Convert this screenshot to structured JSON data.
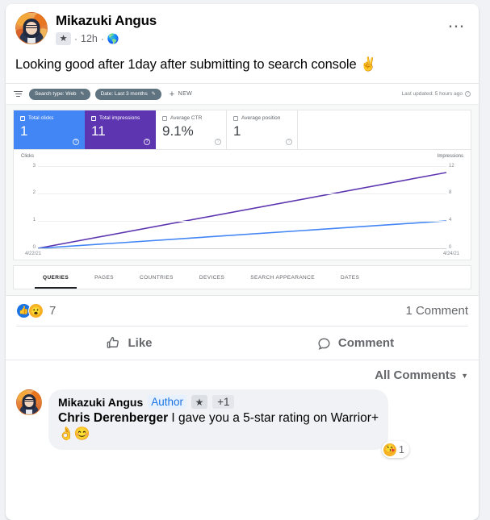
{
  "post": {
    "author": "Mikazuki Angus",
    "badge_icon": "star-icon",
    "time": "12h",
    "audience_icon": "public-globe-icon",
    "meta_dot": "·",
    "menu_icon": "ellipsis-icon",
    "text": "Looking good after 1day after submitting to search console ✌️"
  },
  "gsc": {
    "toolbar": {
      "filter_icon": "filter-icon",
      "chips": [
        {
          "label": "Search type: Web",
          "edit_icon": "pencil-icon"
        },
        {
          "label": "Date: Last 3 months",
          "edit_icon": "pencil-icon"
        }
      ],
      "new_label": "NEW",
      "new_icon": "plus-icon",
      "last_updated": "Last updated: 5 hours ago",
      "help_icon": "question-circle-icon"
    },
    "cards": [
      {
        "label": "Total clicks",
        "value": "1",
        "checked": true,
        "style": "blue",
        "check_mark": "✓"
      },
      {
        "label": "Total impressions",
        "value": "11",
        "checked": true,
        "style": "purple",
        "check_mark": "✓"
      },
      {
        "label": "Average CTR",
        "value": "9.1%",
        "checked": false,
        "style": "plain",
        "check_mark": ""
      },
      {
        "label": "Average position",
        "value": "1",
        "checked": false,
        "style": "plain",
        "check_mark": ""
      }
    ],
    "tabs": [
      {
        "label": "QUERIES",
        "active": true
      },
      {
        "label": "PAGES",
        "active": false
      },
      {
        "label": "COUNTRIES",
        "active": false
      },
      {
        "label": "DEVICES",
        "active": false
      },
      {
        "label": "SEARCH APPEARANCE",
        "active": false
      },
      {
        "label": "DATES",
        "active": false
      }
    ],
    "colors": {
      "clicks_line": "#4285f4",
      "impressions_line": "#5e35b1",
      "card_blue": "#4285f4",
      "card_purple": "#5e35b1"
    }
  },
  "chart_data": {
    "type": "line",
    "title": "",
    "xlabel": "",
    "ylabel": "Clicks",
    "y2label": "Impressions",
    "x": [
      "4/22/21",
      "4/24/21"
    ],
    "x_tick_labels": [
      "4/22/21",
      "4/24/21"
    ],
    "y_tick_labels": [
      "3",
      "2",
      "1",
      "0"
    ],
    "y2_tick_labels": [
      "12",
      "8",
      "4",
      "0"
    ],
    "ylim": [
      0,
      3
    ],
    "y2lim": [
      0,
      12
    ],
    "grid": true,
    "legend": "none",
    "series": [
      {
        "name": "Clicks",
        "axis": "left",
        "color": "#4285f4",
        "values": [
          0,
          1
        ]
      },
      {
        "name": "Impressions",
        "axis": "right",
        "color": "#5e35b1",
        "values": [
          0,
          11
        ]
      }
    ]
  },
  "engagement": {
    "reactions": [
      {
        "name": "like-reaction-icon",
        "glyph": "👍"
      },
      {
        "name": "wow-reaction-icon",
        "glyph": "😮"
      }
    ],
    "reaction_count": "7",
    "comment_count": "1 Comment"
  },
  "actions": [
    {
      "label": "Like",
      "icon": "thumbs-up-icon"
    },
    {
      "label": "Comment",
      "icon": "speech-bubble-icon"
    }
  ],
  "comments_header": {
    "label": "All Comments",
    "caret_icon": "chevron-down-icon"
  },
  "comments": [
    {
      "author": "Mikazuki Angus",
      "author_tag": "Author",
      "badge_icon": "star-icon",
      "extra_badge": "+1",
      "mention": "Chris Derenberger",
      "body": " I gave you a 5-star rating on Warrior+",
      "emojis": "👌😊",
      "reaction": {
        "glyph": "😘",
        "count": "1"
      }
    }
  ]
}
